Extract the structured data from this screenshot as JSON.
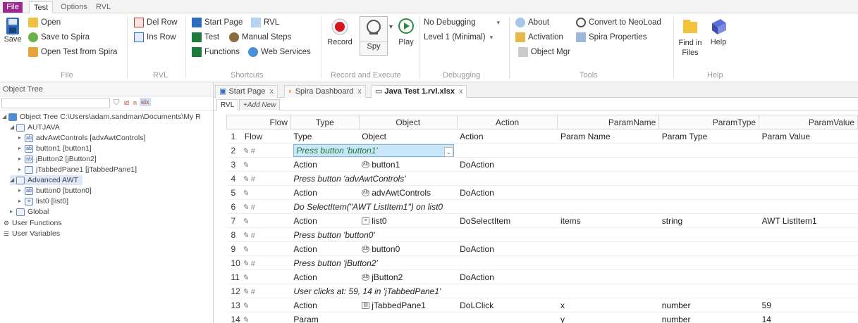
{
  "menu": {
    "items": [
      "File",
      "Test",
      "Options",
      "RVL"
    ],
    "active": "Test"
  },
  "ribbon": {
    "save": "Save",
    "file": {
      "open": "Open",
      "save_spira": "Save to Spira",
      "open_spira": "Open Test from Spira",
      "group": "File"
    },
    "rvl": {
      "del_row": "Del Row",
      "ins_row": "Ins Row",
      "group": "RVL"
    },
    "shortcuts": {
      "start_page": "Start Page",
      "rvl": "RVL",
      "test": "Test",
      "manual_steps": "Manual Steps",
      "functions": "Functions",
      "web_services": "Web Services",
      "group": "Shortcuts"
    },
    "record": {
      "record": "Record",
      "spy": "Spy",
      "play": "Play",
      "group": "Record and Execute"
    },
    "debugging": {
      "mode": "No Debugging",
      "level": "Level 1 (Minimal)",
      "group": "Debugging"
    },
    "tools": {
      "about": "About",
      "activation": "Activation",
      "object_mgr": "Object Mgr",
      "convert": "Convert to NeoLoad",
      "spira_props": "Spira Properties",
      "group": "Tools"
    },
    "help": {
      "find_files": "Find in Files",
      "help": "Help",
      "group": "Help"
    }
  },
  "tree": {
    "title": "Object Tree",
    "filters": [
      "id",
      "n",
      "idx"
    ],
    "nodes": [
      {
        "label": "Object Tree C:\\Users\\adam.sandman\\Documents\\My R"
      },
      {
        "label": "AUTJAVA"
      },
      {
        "label": "advAwtControls [advAwtControls]"
      },
      {
        "label": "button1 [button1]"
      },
      {
        "label": "jButton2 [jButton2]"
      },
      {
        "label": "jTabbedPane1 [jTabbedPane1]"
      },
      {
        "label": "Advanced AWT"
      },
      {
        "label": "button0 [button0]"
      },
      {
        "label": "list0 [list0]"
      },
      {
        "label": "Global"
      },
      {
        "label": "User Functions"
      },
      {
        "label": "User Variables"
      }
    ]
  },
  "doc_tabs": [
    {
      "label": "Start Page"
    },
    {
      "label": "Spira Dashboard"
    },
    {
      "label": "Java Test 1.rvl.xlsx"
    }
  ],
  "sub_tabs": [
    "RVL",
    "+Add New"
  ],
  "grid": {
    "columns": [
      "Flow",
      "Type",
      "Object",
      "Action",
      "ParamName",
      "ParamType",
      "ParamValue"
    ],
    "rows": [
      {
        "n": "1",
        "flow": "Flow",
        "type": "Type",
        "object": "Object",
        "action": "Action",
        "pname": "Param Name",
        "ptype": "Param Type",
        "pvalue": "Param Value"
      },
      {
        "n": "2",
        "flow": "#",
        "comment": "Press button 'button1'"
      },
      {
        "n": "3",
        "type": "Action",
        "object": "button1",
        "action": "DoAction"
      },
      {
        "n": "4",
        "flow": "#",
        "comment": "Press button 'advAwtControls'"
      },
      {
        "n": "5",
        "type": "Action",
        "object": "advAwtControls",
        "action": "DoAction"
      },
      {
        "n": "6",
        "flow": "#",
        "comment": "Do SelectItem(\"AWT ListItem1\") on list0"
      },
      {
        "n": "7",
        "type": "Action",
        "object": "list0",
        "action": "DoSelectItem",
        "pname": "items",
        "ptype": "string",
        "pvalue": "AWT ListItem1"
      },
      {
        "n": "8",
        "flow": "#",
        "comment": "Press button 'button0'"
      },
      {
        "n": "9",
        "type": "Action",
        "object": "button0",
        "action": "DoAction"
      },
      {
        "n": "10",
        "flow": "#",
        "comment": "Press button 'jButton2'"
      },
      {
        "n": "11",
        "type": "Action",
        "object": "jButton2",
        "action": "DoAction"
      },
      {
        "n": "12",
        "flow": "#",
        "comment": "User clicks at: 59, 14 in 'jTabbedPane1'"
      },
      {
        "n": "13",
        "type": "Action",
        "object": "jTabbedPane1",
        "action": "DoLClick",
        "pname": "x",
        "ptype": "number",
        "pvalue": "59"
      },
      {
        "n": "14",
        "type": "Param",
        "pname": "y",
        "ptype": "number",
        "pvalue": "14"
      }
    ]
  }
}
